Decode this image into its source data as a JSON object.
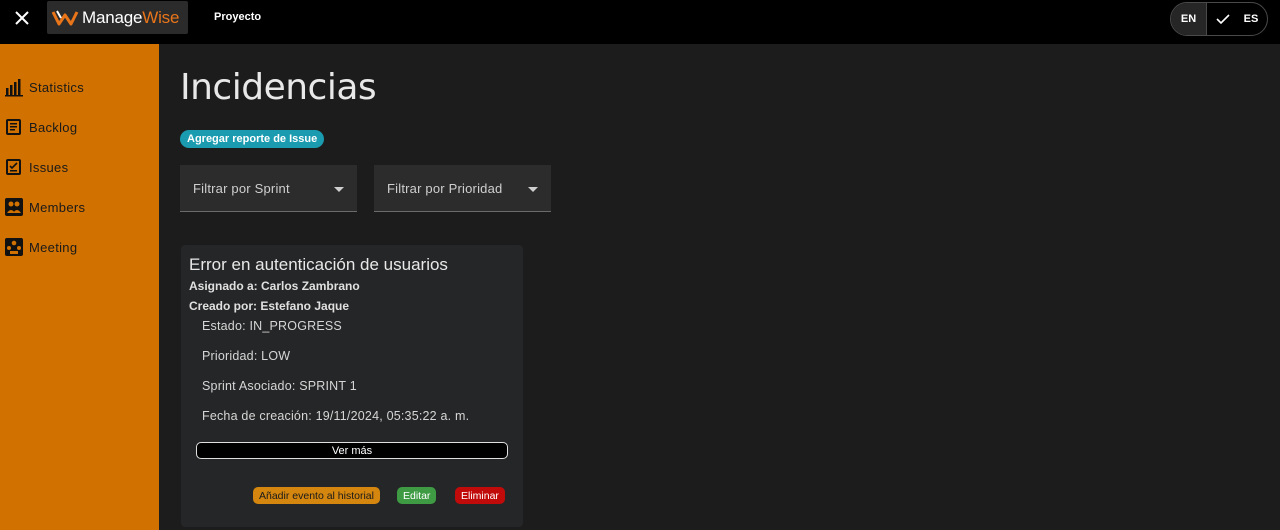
{
  "header": {
    "logo": {
      "part1": "Manage",
      "part2": "Wise"
    },
    "project_link": "Proyecto",
    "language": {
      "en": "EN",
      "es": "ES",
      "selected": "ES"
    }
  },
  "sidebar": {
    "items": [
      {
        "label": "Statistics",
        "icon": "bar-chart-icon"
      },
      {
        "label": "Backlog",
        "icon": "backlog-icon"
      },
      {
        "label": "Issues",
        "icon": "issues-icon"
      },
      {
        "label": "Members",
        "icon": "members-icon"
      },
      {
        "label": "Meeting",
        "icon": "meeting-icon"
      }
    ]
  },
  "main": {
    "title": "Incidencias",
    "add_button": "Agregar reporte de Issue",
    "filters": {
      "sprint": "Filtrar por Sprint",
      "priority": "Filtrar por Prioridad"
    },
    "issue": {
      "title": "Error en autenticación de usuarios",
      "assigned": "Asignado a: Carlos Zambrano",
      "created_by": "Creado por: Estefano Jaque",
      "status": "Estado: IN_PROGRESS",
      "priority": "Prioridad: LOW",
      "sprint": "Sprint Asociado: SPRINT 1",
      "created_date": "Fecha de creación: 19/11/2024, 05:35:22 a. m.",
      "view_more": "Ver más",
      "actions": {
        "history": "Añadir evento al historial",
        "edit": "Editar",
        "delete": "Eliminar"
      }
    }
  },
  "colors": {
    "sidebar": "#d17100",
    "accent_teal": "#1a9bb0",
    "edit_green": "#3e9b43",
    "delete_red": "#c10b0b",
    "history_orange": "#d4860f"
  }
}
